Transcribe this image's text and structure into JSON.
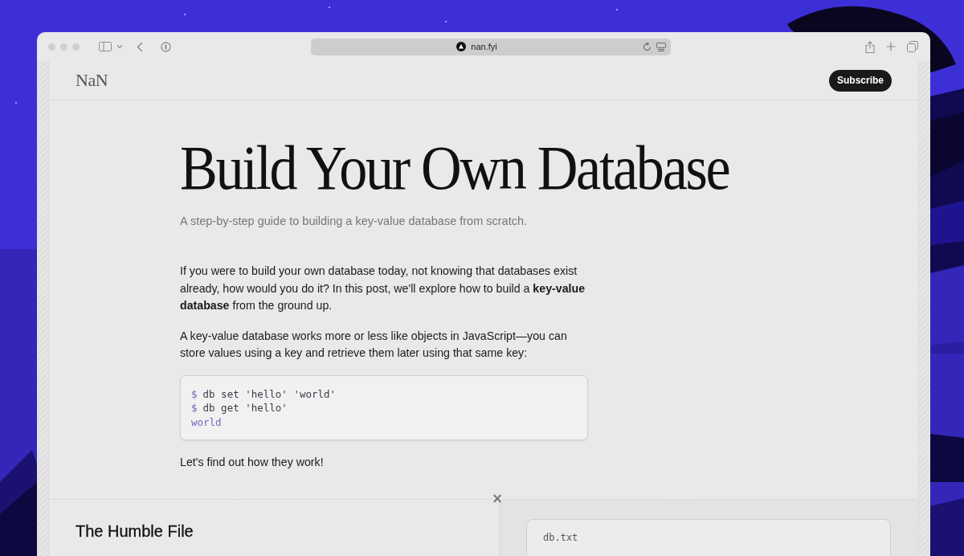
{
  "browser": {
    "address": "nan.fyi"
  },
  "site": {
    "logo": "NaN",
    "subscribe": "Subscribe"
  },
  "article": {
    "title": "Build Your Own Database",
    "subtitle": "A step-by-step guide to building a key-value database from scratch.",
    "paragraphs": [
      "If you were to build your own database today, not knowing that databases exist already, how would you do it? In this post, we'll explore how to build a **key-value database** from the ground up.",
      "A key-value database works more or less like objects in JavaScript—you can store values using a key and retrieve them later using that same key:"
    ],
    "code": [
      {
        "kind": "command",
        "prompt": "$",
        "text": "db set 'hello' 'world'"
      },
      {
        "kind": "command",
        "prompt": "$",
        "text": "db get 'hello'"
      },
      {
        "kind": "output",
        "text": "world"
      }
    ],
    "closing": "Let's find out how they work!"
  },
  "section": {
    "close": "×",
    "heading": "The Humble File",
    "file_name": "db.txt"
  }
}
